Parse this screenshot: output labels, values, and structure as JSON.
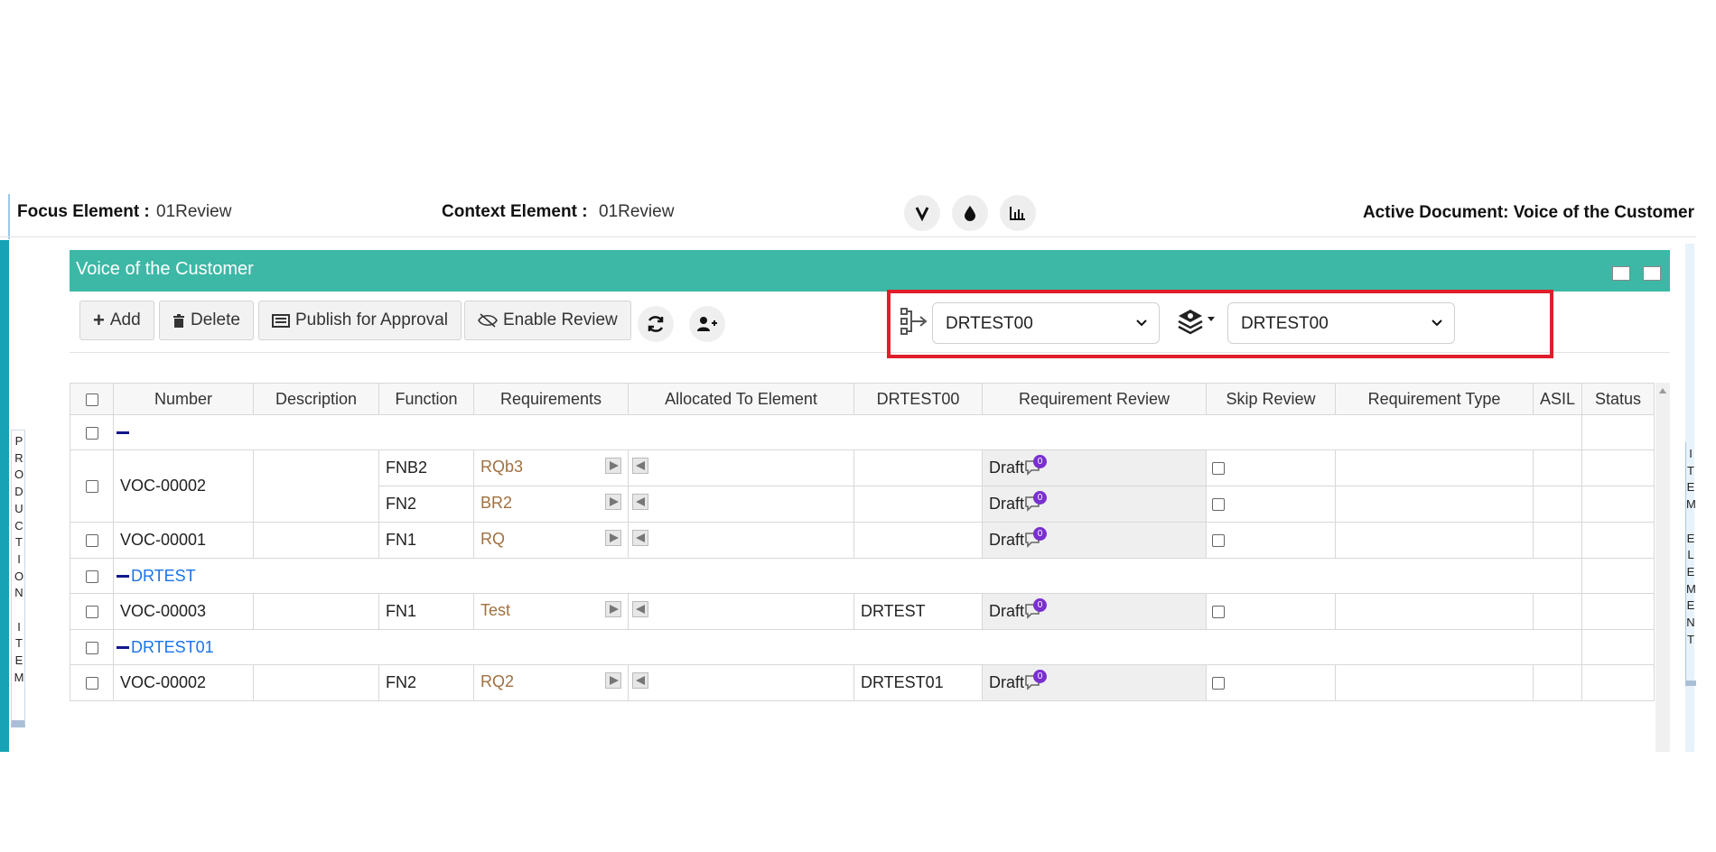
{
  "context_bar": {
    "focus_label": "Focus Element :",
    "focus_value": "01Review",
    "context_label": "Context Element :",
    "context_value": "01Review",
    "active_document": "Active Document: Voice of the Customer"
  },
  "left_rail": {
    "vertical_text": "PRODUCTION ITEM"
  },
  "right_rail": {
    "vertical_text": "ITEM ELEMENT"
  },
  "panel": {
    "title": "Voice of the Customer"
  },
  "toolbar": {
    "add_label": "Add",
    "delete_label": "Delete",
    "publish_label": "Publish for Approval",
    "enable_review_label": "Enable Review"
  },
  "filters": {
    "first_select_value": "DRTEST00",
    "second_select_value": "DRTEST00"
  },
  "table": {
    "headers": [
      "Number",
      "Description",
      "Function",
      "Requirements",
      "Allocated To Element",
      "DRTEST00",
      "Requirement Review",
      "Skip Review",
      "Requirement Type",
      "ASIL",
      "Status"
    ],
    "groups": [
      {
        "name": "",
        "rows": [
          {
            "number": "VOC-00002",
            "description": "",
            "functions": [
              {
                "function": "FNB2",
                "requirement": "RQb3",
                "element": "",
                "review": "Draft",
                "count": "0"
              },
              {
                "function": "FN2",
                "requirement": "BR2",
                "element": "",
                "review": "Draft",
                "count": "0"
              }
            ]
          },
          {
            "number": "VOC-00001",
            "description": "",
            "functions": [
              {
                "function": "FN1",
                "requirement": "RQ",
                "element": "",
                "review": "Draft",
                "count": "0"
              }
            ]
          }
        ]
      },
      {
        "name": "DRTEST",
        "rows": [
          {
            "number": "VOC-00003",
            "description": "",
            "functions": [
              {
                "function": "FN1",
                "requirement": "Test",
                "element": "DRTEST",
                "review": "Draft",
                "count": "0"
              }
            ]
          }
        ]
      },
      {
        "name": "DRTEST01",
        "rows": [
          {
            "number": "VOC-00002",
            "description": "",
            "functions": [
              {
                "function": "FN2",
                "requirement": "RQ2",
                "element": "DRTEST01",
                "review": "Draft",
                "count": "0"
              }
            ]
          }
        ]
      }
    ]
  },
  "colors": {
    "accent": "#3db8a6",
    "rail": "#17a3b5",
    "highlight": "#e01e2b",
    "badge": "#7a2fd0"
  }
}
